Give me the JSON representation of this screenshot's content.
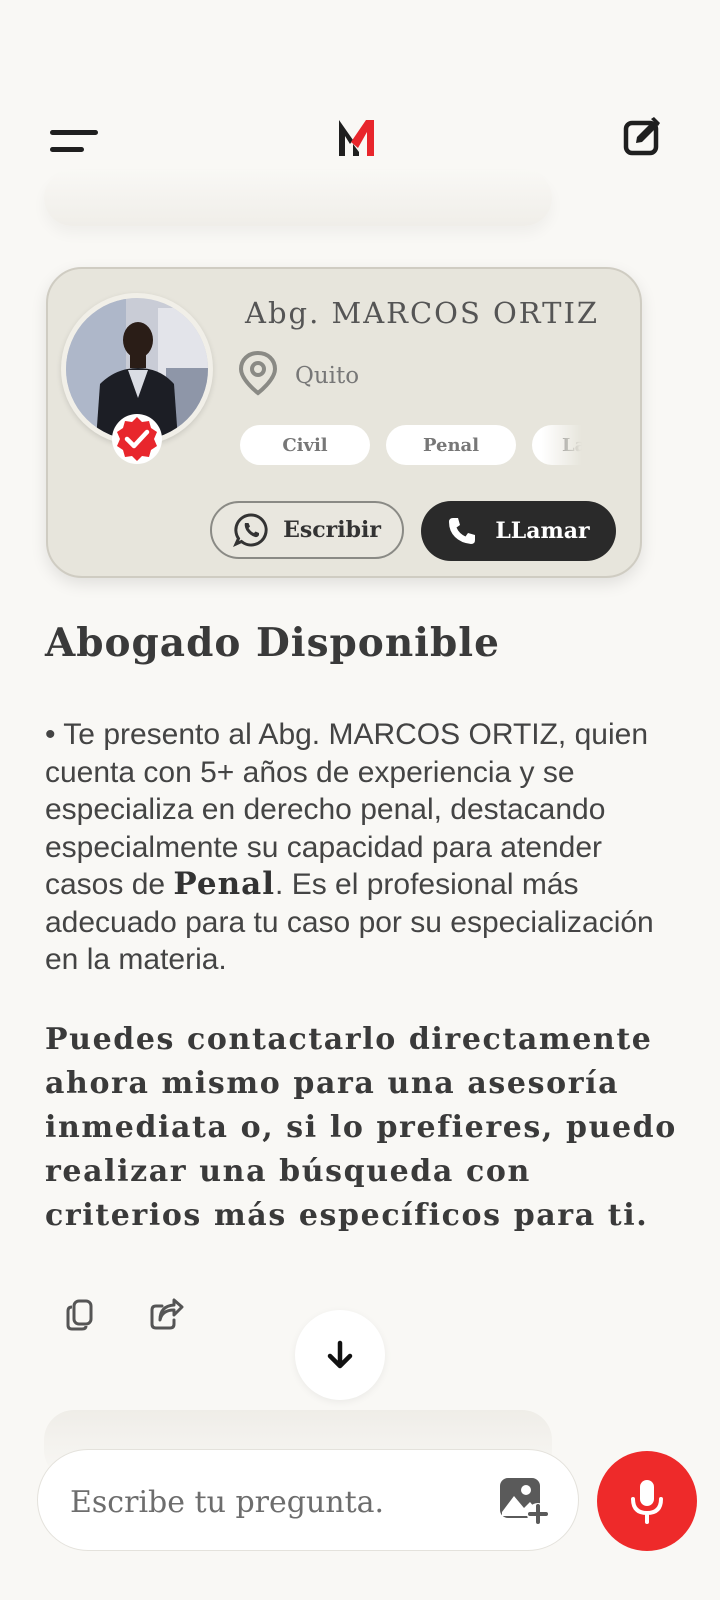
{
  "header": {
    "menu_icon": "hamburger-menu-icon",
    "logo_icon": "m-monogram-logo",
    "edit_icon": "new-chat-edit-icon"
  },
  "lawyer_card": {
    "name": "Abg. MARCOS ORTIZ",
    "location": "Quito",
    "tags": [
      "Civil",
      "Penal",
      "Laboral"
    ],
    "write_button": "Escribir",
    "call_button": "LLamar",
    "colors": {
      "card_bg": "#e7e5dc",
      "call_bg": "#2a2a2a",
      "verified": "#e8262c"
    }
  },
  "message": {
    "heading": "Abogado Disponible",
    "paragraph_before": "• Te presento al Abg. MARCOS ORTIZ, quien cuenta con 5+ años de experiencia y se especializa en derecho penal, destacando especialmente su capacidad para atender casos de ",
    "paragraph_bold": "Penal",
    "paragraph_after": ". Es el profesional más adecuado para tu caso por su especialización en la materia.",
    "closing": "Puedes contactarlo directamente ahora mismo para una asesoría inmediata o, si lo prefieres, puedo realizar una búsqueda con criterios más específicos para ti."
  },
  "composer": {
    "placeholder": "Escribe tu pregunta.",
    "value": "",
    "mic_color": "#ee2a2a"
  }
}
